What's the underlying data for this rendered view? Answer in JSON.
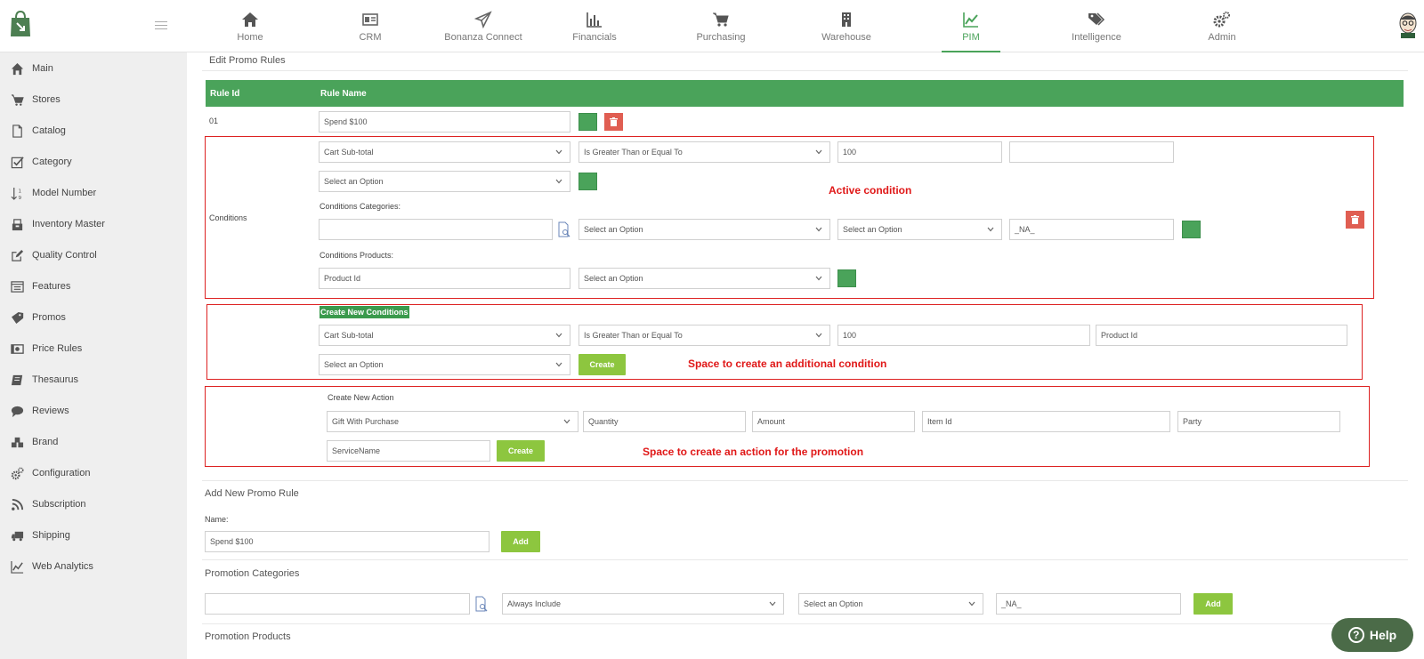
{
  "nav": {
    "items": [
      {
        "label": "Home",
        "icon": "home-icon"
      },
      {
        "label": "CRM",
        "icon": "crm-card-icon"
      },
      {
        "label": "Bonanza Connect",
        "icon": "paper-plane-icon"
      },
      {
        "label": "Financials",
        "icon": "bar-chart-icon"
      },
      {
        "label": "Purchasing",
        "icon": "cart-icon"
      },
      {
        "label": "Warehouse",
        "icon": "building-icon"
      },
      {
        "label": "PIM",
        "icon": "line-chart-icon"
      },
      {
        "label": "Intelligence",
        "icon": "tags-icon"
      },
      {
        "label": "Admin",
        "icon": "gears-icon"
      }
    ],
    "active": "PIM",
    "accent": "#4aa35a"
  },
  "sidebar": {
    "items": [
      {
        "label": "Main",
        "icon": "home-icon"
      },
      {
        "label": "Stores",
        "icon": "cart-icon"
      },
      {
        "label": "Catalog",
        "icon": "file-icon"
      },
      {
        "label": "Category",
        "icon": "checkbox-icon"
      },
      {
        "label": "Model Number",
        "icon": "sort-numeric-icon"
      },
      {
        "label": "Inventory Master",
        "icon": "inventory-icon"
      },
      {
        "label": "Quality Control",
        "icon": "edit-icon"
      },
      {
        "label": "Features",
        "icon": "list-icon"
      },
      {
        "label": "Promos",
        "icon": "tag-icon"
      },
      {
        "label": "Price Rules",
        "icon": "money-icon"
      },
      {
        "label": "Thesaurus",
        "icon": "book-icon"
      },
      {
        "label": "Reviews",
        "icon": "comment-icon"
      },
      {
        "label": "Brand",
        "icon": "cubes-icon"
      },
      {
        "label": "Configuration",
        "icon": "gears-icon"
      },
      {
        "label": "Subscription",
        "icon": "rss-icon"
      },
      {
        "label": "Shipping",
        "icon": "truck-icon"
      },
      {
        "label": "Web Analytics",
        "icon": "line-chart-icon"
      }
    ]
  },
  "edit_rules": {
    "title": "Edit Promo Rules",
    "col_rule_id": "Rule Id",
    "col_rule_name": "Rule Name",
    "rule_id": "01",
    "rule_name": "Spend $100",
    "conditions_label": "Conditions",
    "cond": {
      "field": "Cart Sub-total",
      "operator": "Is Greater Than or Equal To",
      "value": "100",
      "extra": "",
      "option": "Select an Option"
    },
    "categories_label": "Conditions Categories:",
    "categories": {
      "search": "",
      "opt1": "Select an Option",
      "opt2": "Select an Option",
      "value": "_NA_"
    },
    "products_label": "Conditions Products:",
    "products": {
      "product_id": "Product Id",
      "opt": "Select an Option"
    }
  },
  "new_condition": {
    "title": "Create New Conditions",
    "field": "Cart Sub-total",
    "operator": "Is Greater Than or Equal To",
    "value": "100",
    "product_id": "Product Id",
    "option": "Select an Option",
    "create": "Create"
  },
  "new_action": {
    "title": "Create New Action",
    "type": "Gift With Purchase",
    "quantity": "Quantity",
    "amount": "Amount",
    "item_id": "Item Id",
    "party": "Party",
    "service_name": "ServiceName",
    "create": "Create"
  },
  "annotations": {
    "active": "Active condition",
    "additional": "Space to create an additional condition",
    "action": "Space to create an action for the promotion"
  },
  "add_rule": {
    "title": "Add New Promo Rule",
    "name_label": "Name:",
    "name_value": "Spend $100",
    "add": "Add"
  },
  "promo_categories": {
    "title": "Promotion Categories",
    "search": "",
    "include": "Always Include",
    "opt": "Select an Option",
    "value": "_NA_",
    "add": "Add"
  },
  "promo_products": {
    "title": "Promotion Products"
  },
  "help": {
    "label": "Help"
  }
}
